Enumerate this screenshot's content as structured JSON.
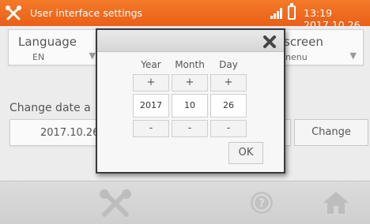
{
  "titlebar": {
    "title": "User interface settings",
    "clock": "13:19 2017.10.26"
  },
  "settings": {
    "language_label": "Language",
    "language_value": "EN",
    "screen_label": "screen",
    "screen_value": "nenu",
    "change_date_label": "Change date a",
    "date_value": "2017.10.26",
    "change_button": "Change"
  },
  "dialog": {
    "columns": [
      {
        "header": "Year",
        "plus": "+",
        "value": "2017",
        "minus": "-"
      },
      {
        "header": "Month",
        "plus": "+",
        "value": "10",
        "minus": "-"
      },
      {
        "header": "Day",
        "plus": "+",
        "value": "26",
        "minus": "-"
      }
    ],
    "ok_label": "OK"
  },
  "colors": {
    "titlebar": "#ea5f17",
    "dialog_border": "#3a3a3a",
    "bottombar": "#d4d4d4"
  },
  "icons": [
    "tools-icon",
    "signal-icon",
    "battery-icon",
    "close-icon",
    "help-icon",
    "home-icon"
  ]
}
